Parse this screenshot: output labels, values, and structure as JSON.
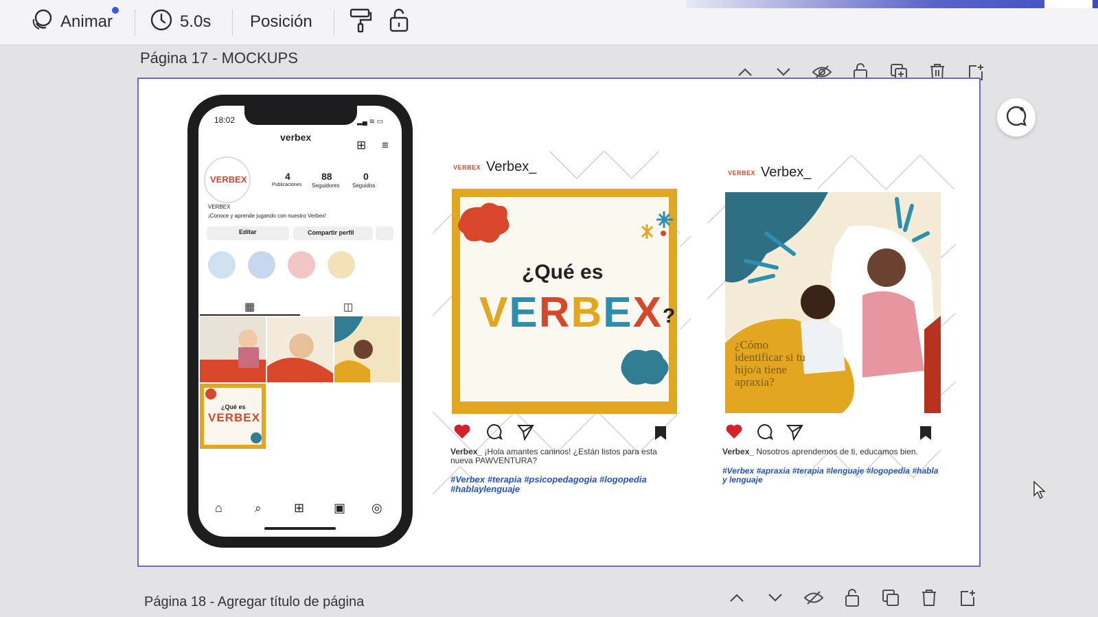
{
  "toolbar": {
    "animate_label": "Animar",
    "duration_label": "5.0s",
    "position_label": "Posición"
  },
  "pages": {
    "current_title": "Página 17 - MOCKUPS",
    "next_title": "Página 18 - Agregar título de página"
  },
  "phone": {
    "time": "18:02",
    "username": "verbex",
    "profile_logo": "VERBEX",
    "stats": [
      {
        "value": "4",
        "label": "Publicaciones"
      },
      {
        "value": "88",
        "label": "Seguidores"
      },
      {
        "value": "0",
        "label": "Seguidos"
      }
    ],
    "bio_name": "VERBEX",
    "bio_text": "¡Conoce y aprende jugando con nuestro Verbex!",
    "edit_button": "Editar",
    "share_button": "Compartir perfil",
    "grid_post_title": "¿Qué es",
    "grid_post_brand": "VERBEX"
  },
  "post1": {
    "account": "Verbex_",
    "mini_logo": "VERBEX",
    "headline": "¿Qué es",
    "brand_letters": [
      "V",
      "E",
      "R",
      "B",
      "E",
      "X"
    ],
    "brand_colors": [
      "#e2a620",
      "#2b8fb0",
      "#d9472b",
      "#e2a620",
      "#2b8fb0",
      "#d9472b"
    ],
    "question_mark": "?",
    "caption_user": "Verbex_",
    "caption_text": "¡Hola amantes caninos! ¿Están listos para esta nueva PAWVENTURA?",
    "hashtags": "#Verbex #terapia #psicopedagogia #logopedia #hablaylenguaje"
  },
  "post2": {
    "account": "Verbex_",
    "mini_logo": "VERBEX",
    "overlay_text": "¿Cómo identificar si tu hijo/a tiene apraxia?",
    "caption_user": "Verbex_",
    "caption_text": "Nosotros aprendemos de ti, educamos bien.",
    "hashtags": "#Verbex #apraxia #terapia #lenguaje #logopedia #habla y lenguaje"
  },
  "colors": {
    "canvas_border": "#6f63d8",
    "post_frame": "#e2a620",
    "like_red": "#d8202a",
    "teal": "#2f7c93",
    "orange_red": "#d9472b"
  },
  "icons": [
    "animate-icon",
    "clock-icon",
    "paint-roller-icon",
    "lock-icon",
    "chevron-up-icon",
    "chevron-down-icon",
    "hide-icon",
    "lock-page-icon",
    "duplicate-icon",
    "trash-icon",
    "add-page-icon",
    "comment-add-icon"
  ]
}
